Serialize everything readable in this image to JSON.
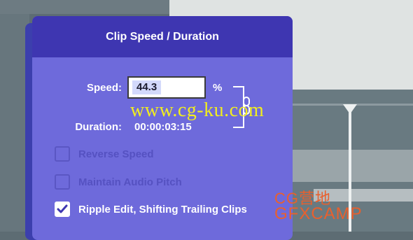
{
  "dialog": {
    "title": "Clip Speed / Duration",
    "speed_label": "Speed:",
    "speed_value": "44.3",
    "speed_unit": "%",
    "duration_label": "Duration:",
    "duration_value": "00:00:03:15",
    "link_icon": "chain-link-icon",
    "options": [
      {
        "label": "Reverse Speed",
        "checked": false,
        "enabled": false
      },
      {
        "label": "Maintain Audio Pitch",
        "checked": false,
        "enabled": false
      },
      {
        "label": "Ripple Edit, Shifting Trailing Clips",
        "checked": true,
        "enabled": true
      }
    ]
  },
  "watermarks": {
    "center": "www.cg-ku.com",
    "logo_line1": "CG营地",
    "logo_line2": "GFXCAMP"
  },
  "colors": {
    "dialog_header": "#3e36b1",
    "dialog_body": "#6e6adb",
    "watermark_yellow": "#f2ee1e",
    "watermark_orange": "#e9602d"
  }
}
